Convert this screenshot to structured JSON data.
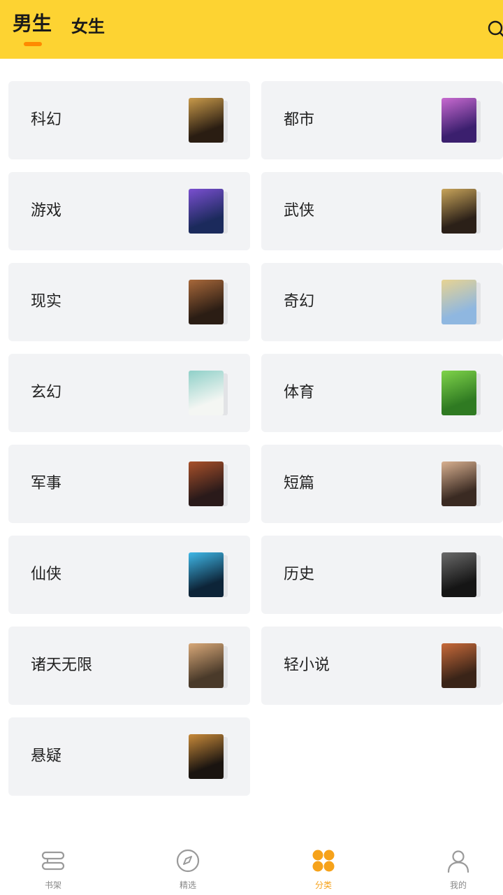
{
  "header": {
    "tabs": [
      {
        "label": "男生",
        "active": true
      },
      {
        "label": "女生",
        "active": false
      }
    ],
    "search_icon": "search-icon"
  },
  "categories": [
    {
      "label": "科幻",
      "cover_colors": [
        "#2a1d12",
        "#c99a4a"
      ]
    },
    {
      "label": "都市",
      "cover_colors": [
        "#3b1f6e",
        "#c86ad0"
      ]
    },
    {
      "label": "游戏",
      "cover_colors": [
        "#1b2a5c",
        "#7a4fd0"
      ]
    },
    {
      "label": "武侠",
      "cover_colors": [
        "#2b2018",
        "#c8a45a"
      ]
    },
    {
      "label": "现实",
      "cover_colors": [
        "#2b1d14",
        "#a8683a"
      ]
    },
    {
      "label": "奇幻",
      "cover_colors": [
        "#8fb7e0",
        "#e7d392"
      ]
    },
    {
      "label": "玄幻",
      "cover_colors": [
        "#f4f6f3",
        "#8fd0c8"
      ]
    },
    {
      "label": "体育",
      "cover_colors": [
        "#2f7a22",
        "#7fd34a"
      ]
    },
    {
      "label": "军事",
      "cover_colors": [
        "#2a1a1a",
        "#a8502a"
      ]
    },
    {
      "label": "短篇",
      "cover_colors": [
        "#3a2a22",
        "#d8b090"
      ]
    },
    {
      "label": "仙侠",
      "cover_colors": [
        "#0d2438",
        "#3fb8e8"
      ]
    },
    {
      "label": "历史",
      "cover_colors": [
        "#151515",
        "#6a6a6a"
      ]
    },
    {
      "label": "诸天无限",
      "cover_colors": [
        "#4a3a2a",
        "#d8a878"
      ]
    },
    {
      "label": "轻小说",
      "cover_colors": [
        "#3a2418",
        "#c86a3a"
      ]
    },
    {
      "label": "悬疑",
      "cover_colors": [
        "#1a1410",
        "#c88a3a"
      ]
    }
  ],
  "tabbar": {
    "items": [
      {
        "label": "书架",
        "icon": "bookshelf-icon",
        "active": false
      },
      {
        "label": "精选",
        "icon": "compass-icon",
        "active": false
      },
      {
        "label": "分类",
        "icon": "category-grid-icon",
        "active": true
      },
      {
        "label": "我的",
        "icon": "user-icon",
        "active": false
      }
    ]
  },
  "colors": {
    "header_bg": "#fdd332",
    "accent": "#f6a21a",
    "indicator": "#ff8a00",
    "card_bg": "#f2f3f5"
  }
}
